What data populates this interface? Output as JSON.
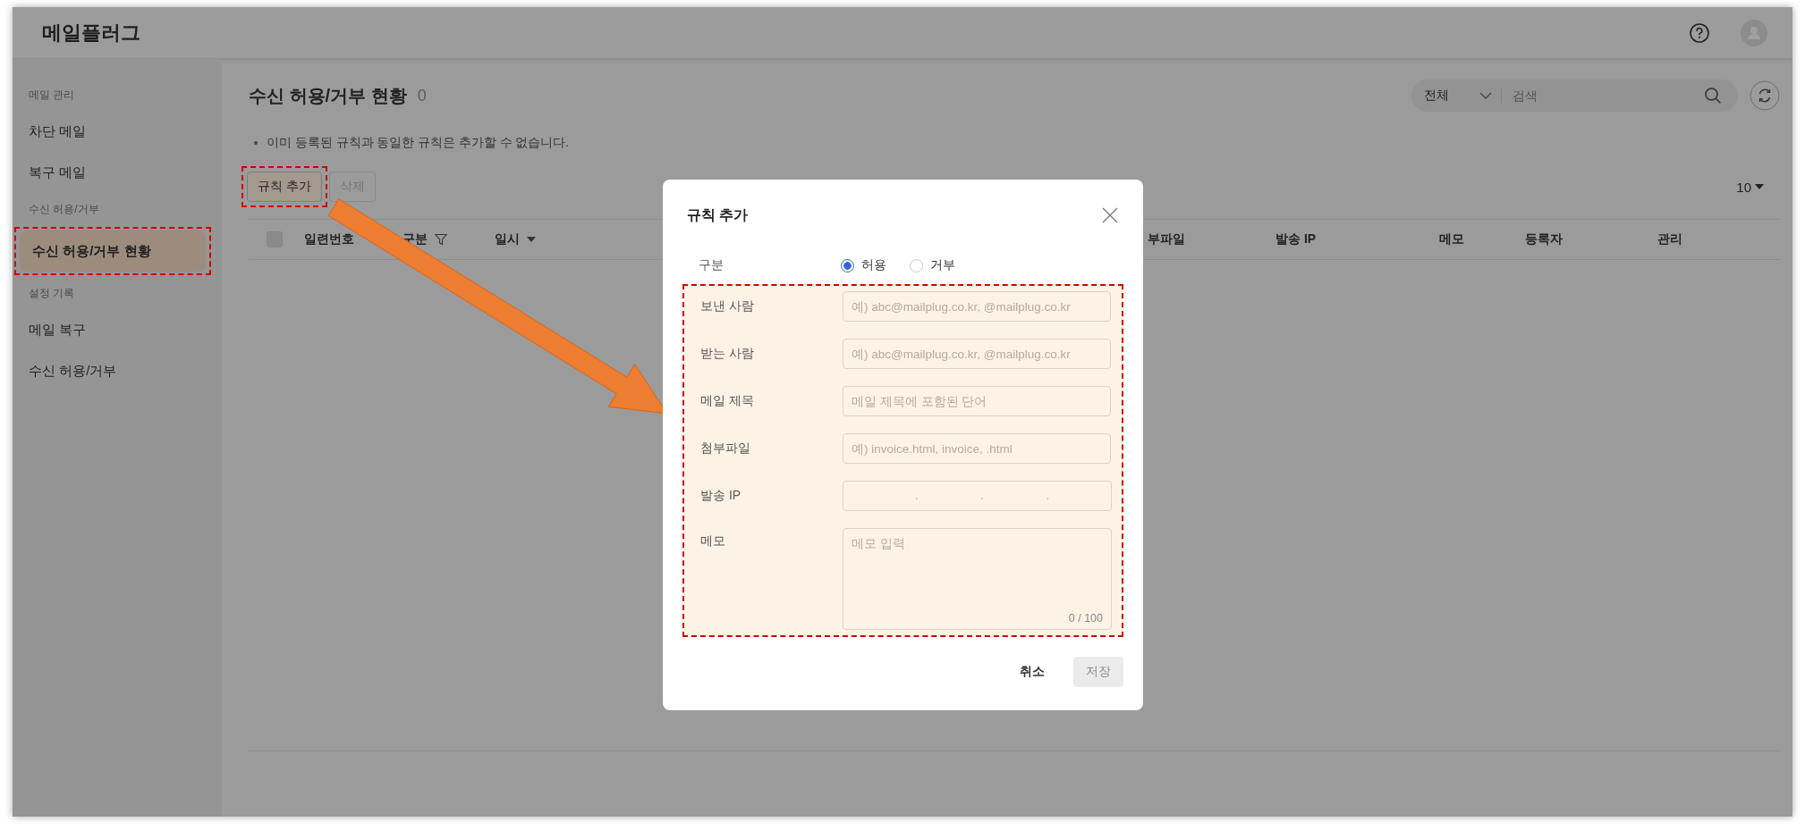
{
  "app": {
    "title": "메일플러그"
  },
  "sidebar": {
    "sections": [
      {
        "heading": "메일 관리",
        "items": [
          {
            "label": "차단 메일",
            "selected": false,
            "highlighted": false
          },
          {
            "label": "복구 메일",
            "selected": false,
            "highlighted": false
          }
        ]
      },
      {
        "heading": "수신 허용/거부",
        "items": [
          {
            "label": "수신 허용/거부 현황",
            "selected": true,
            "highlighted": true
          }
        ]
      },
      {
        "heading": "설정 기록",
        "items": [
          {
            "label": "메일 복구",
            "selected": false,
            "highlighted": false
          },
          {
            "label": "수신 허용/거부",
            "selected": false,
            "highlighted": false
          }
        ]
      }
    ]
  },
  "page": {
    "title": "수신 허용/거부 현황",
    "count": "0",
    "notice": "이미 등록된 규칙과 동일한 규칙은 추가할 수 없습니다.",
    "filter": {
      "value": "전체"
    },
    "search": {
      "placeholder": "검색"
    },
    "buttons": [
      {
        "label": "규칙 추가",
        "disabled": false,
        "highlighted": true
      },
      {
        "label": "삭제",
        "disabled": true,
        "highlighted": false
      }
    ],
    "page_size": "10"
  },
  "table": {
    "select_all": {
      "checked": false
    },
    "columns": [
      {
        "label": "일련번호",
        "kind": "plain"
      },
      {
        "label": "구분",
        "kind": "filter"
      },
      {
        "label": "일시",
        "kind": "sort"
      },
      {
        "label": "부파일",
        "kind": "plain"
      },
      {
        "label": "발송 IP",
        "kind": "plain"
      },
      {
        "label": "메모",
        "kind": "plain"
      },
      {
        "label": "등록자",
        "kind": "plain"
      },
      {
        "label": "관리",
        "kind": "plain"
      }
    ]
  },
  "dialog": {
    "title": "규칙 추가",
    "type_label": "구분",
    "options": [
      {
        "label": "허용",
        "selected": true
      },
      {
        "label": "거부",
        "selected": false
      }
    ],
    "fields_highlighted": true,
    "fields": [
      {
        "label": "보낸 사람",
        "kind": "text",
        "placeholder": "예) abc@mailplug.co.kr, @mailplug.co.kr"
      },
      {
        "label": "받는 사람",
        "kind": "text",
        "placeholder": "예) abc@mailplug.co.kr, @mailplug.co.kr"
      },
      {
        "label": "메일 제목",
        "kind": "text",
        "placeholder": "메일 제목에 포함된 단어"
      },
      {
        "label": "첨부파일",
        "kind": "text",
        "placeholder": "예) invoice.html, invoice, .html"
      },
      {
        "label": "발송 IP",
        "kind": "ip",
        "separators": [
          ".",
          ".",
          "."
        ]
      },
      {
        "label": "메모",
        "kind": "textarea",
        "placeholder": "메모 입력",
        "counter": "0 / 100"
      }
    ],
    "buttons": [
      {
        "label": "취소",
        "disabled": false
      },
      {
        "label": "저장",
        "disabled": true
      }
    ]
  }
}
